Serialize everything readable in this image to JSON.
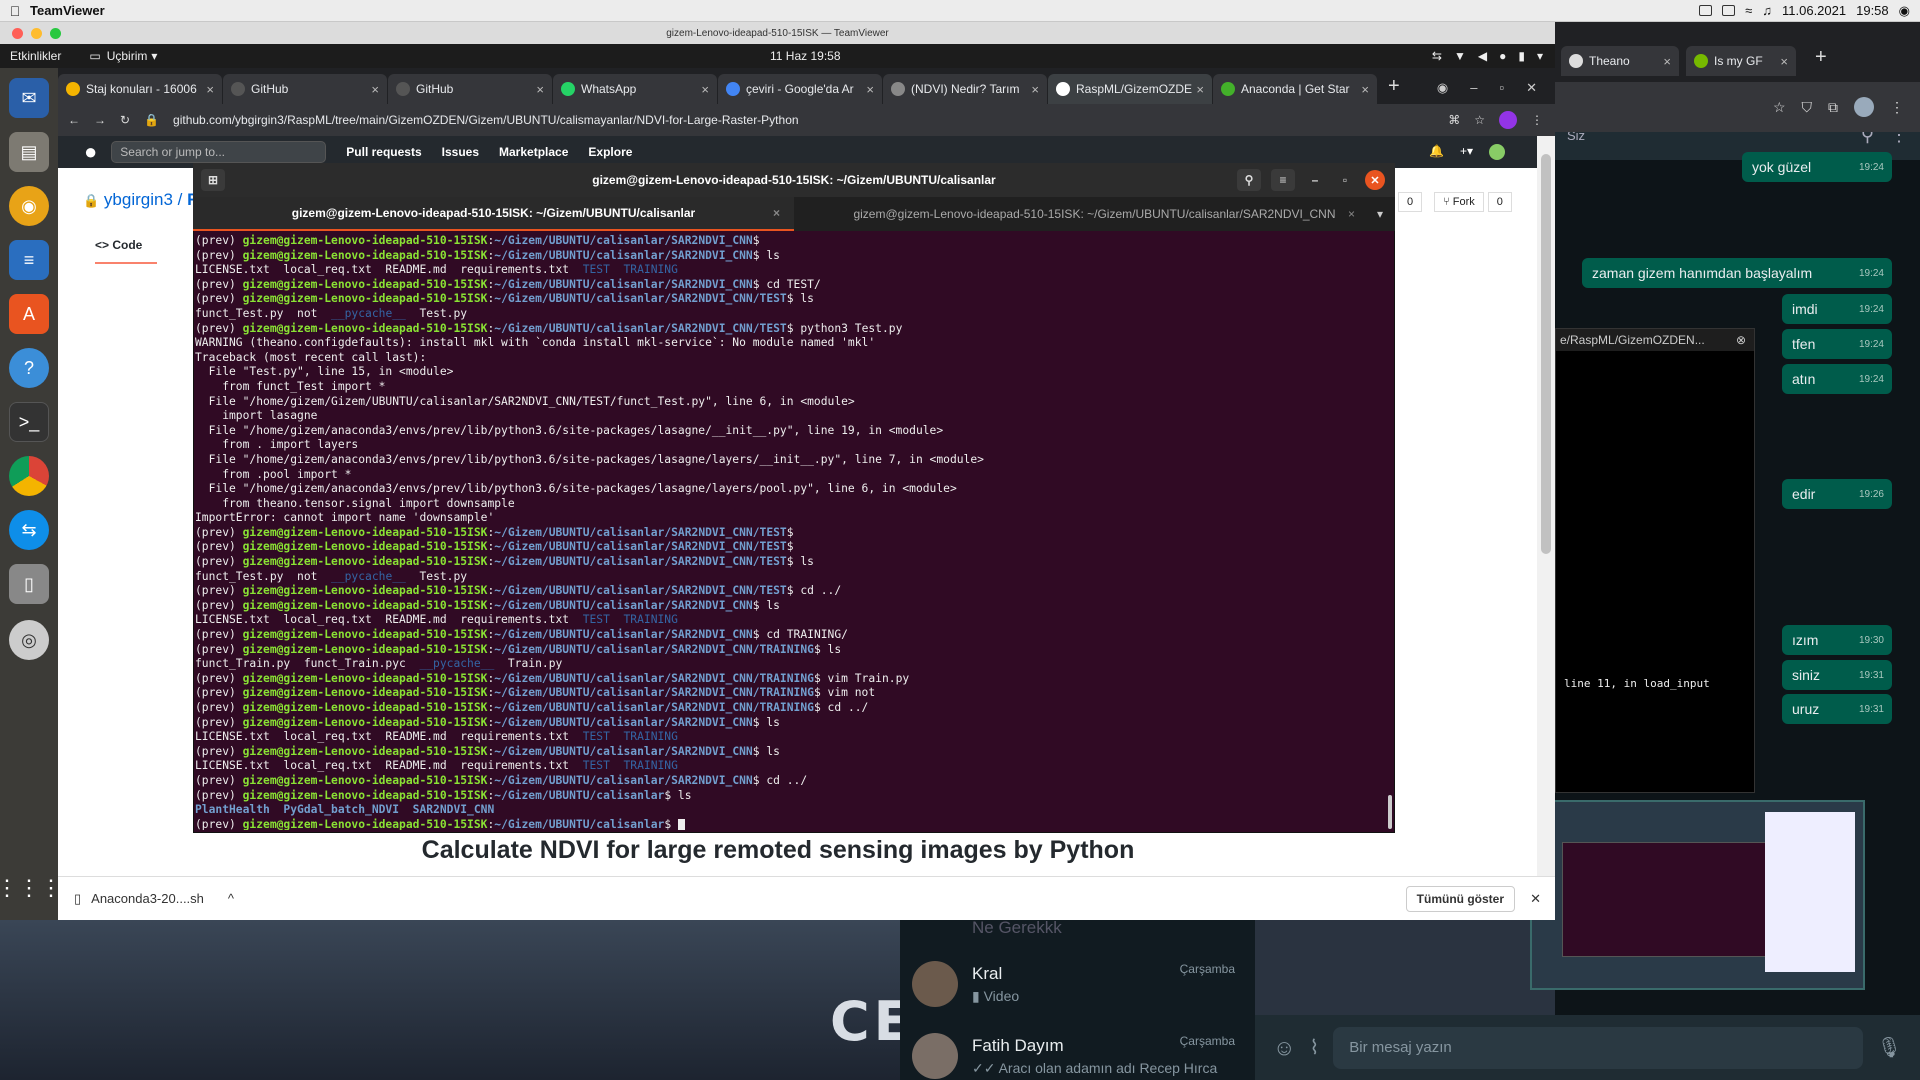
{
  "mac_menubar": {
    "app_name": "TeamViewer",
    "date": "11.06.2021",
    "time": "19:58"
  },
  "teamviewer": {
    "window_title": "gizem-Lenovo-ideapad-510-15ISK — TeamViewer"
  },
  "ubuntu_bar": {
    "activities": "Etkinlikler",
    "app_menu": "Uçbirim",
    "clock": "11 Haz  19:58"
  },
  "chrome": {
    "tabs": [
      {
        "label": "Staj konuları - 16006",
        "color": "#f4b400"
      },
      {
        "label": "GitHub",
        "color": "#555"
      },
      {
        "label": "GitHub",
        "color": "#555"
      },
      {
        "label": "WhatsApp",
        "color": "#25d366"
      },
      {
        "label": "çeviri - Google'da Ar",
        "color": "#4285f4"
      },
      {
        "label": "(NDVI) Nedir? Tarım",
        "color": "#888"
      },
      {
        "label": "RaspML/GizemOZDEN",
        "color": "#fff"
      },
      {
        "label": "Anaconda | Get Star",
        "color": "#43b02a"
      }
    ],
    "url": "github.com/ybgirgin3/RaspML/tree/main/GizemOZDEN/Gizem/UBUNTU/calismayanlar/NDVI-for-Large-Raster-Python",
    "right_tabs": [
      {
        "label": "Theano"
      },
      {
        "label": "Is my GF"
      }
    ]
  },
  "github": {
    "search_placeholder": "Search or jump to...",
    "nav": [
      "Pull requests",
      "Issues",
      "Marketplace",
      "Explore"
    ],
    "repo_owner": "ybgirgin3",
    "repo_sep": "/",
    "repo_name": "R",
    "code_tab": "Code",
    "fork_label": "Fork",
    "fork_count": "0",
    "star_count": "0",
    "readme_title": "Calculate NDVI for large remoted sensing images by Python"
  },
  "downloads": {
    "file": "Anaconda3-20....sh",
    "show_all": "Tümünü göster"
  },
  "terminal": {
    "title": "gizem@gizem-Lenovo-ideapad-510-15ISK: ~/Gizem/UBUNTU/calisanlar",
    "tabs": [
      "gizem@gizem-Lenovo-ideapad-510-15ISK: ~/Gizem/UBUNTU/calisanlar",
      "gizem@gizem-Lenovo-ideapad-510-15ISK: ~/Gizem/UBUNTU/calisanlar/SAR2NDVI_CNN"
    ],
    "lines": [
      [
        [
          "(prev) ",
          ""
        ],
        [
          "gizem@gizem-Lenovo-ideapad-510-15ISK",
          "g"
        ],
        [
          ":",
          ""
        ],
        [
          "~/Gizem/UBUNTU/calisanlar/SAR2NDVI_CNN",
          "b"
        ],
        [
          "$",
          ""
        ]
      ],
      [
        [
          "(prev) ",
          ""
        ],
        [
          "gizem@gizem-Lenovo-ideapad-510-15ISK",
          "g"
        ],
        [
          ":",
          ""
        ],
        [
          "~/Gizem/UBUNTU/calisanlar/SAR2NDVI_CNN",
          "b"
        ],
        [
          "$ ls",
          ""
        ]
      ],
      [
        [
          "LICENSE.txt  local_req.txt  README.md  requirements.txt  ",
          ""
        ],
        [
          "TEST  TRAINING",
          "bl"
        ]
      ],
      [
        [
          "(prev) ",
          ""
        ],
        [
          "gizem@gizem-Lenovo-ideapad-510-15ISK",
          "g"
        ],
        [
          ":",
          ""
        ],
        [
          "~/Gizem/UBUNTU/calisanlar/SAR2NDVI_CNN",
          "b"
        ],
        [
          "$ cd TEST/",
          ""
        ]
      ],
      [
        [
          "(prev) ",
          ""
        ],
        [
          "gizem@gizem-Lenovo-ideapad-510-15ISK",
          "g"
        ],
        [
          ":",
          ""
        ],
        [
          "~/Gizem/UBUNTU/calisanlar/SAR2NDVI_CNN/TEST",
          "b"
        ],
        [
          "$ ls",
          ""
        ]
      ],
      [
        [
          "funct_Test.py  not  ",
          ""
        ],
        [
          "__pycache__",
          "bl"
        ],
        [
          "  Test.py",
          ""
        ]
      ],
      [
        [
          "(prev) ",
          ""
        ],
        [
          "gizem@gizem-Lenovo-ideapad-510-15ISK",
          "g"
        ],
        [
          ":",
          ""
        ],
        [
          "~/Gizem/UBUNTU/calisanlar/SAR2NDVI_CNN/TEST",
          "b"
        ],
        [
          "$ python3 Test.py",
          ""
        ]
      ],
      [
        [
          "WARNING (theano.configdefaults): install mkl with `conda install mkl-service`: No module named 'mkl'",
          ""
        ]
      ],
      [
        [
          "Traceback (most recent call last):",
          ""
        ]
      ],
      [
        [
          "  File \"Test.py\", line 15, in <module>",
          ""
        ]
      ],
      [
        [
          "    from funct_Test import *",
          ""
        ]
      ],
      [
        [
          "  File \"/home/gizem/Gizem/UBUNTU/calisanlar/SAR2NDVI_CNN/TEST/funct_Test.py\", line 6, in <module>",
          ""
        ]
      ],
      [
        [
          "    import lasagne",
          ""
        ]
      ],
      [
        [
          "  File \"/home/gizem/anaconda3/envs/prev/lib/python3.6/site-packages/lasagne/__init__.py\", line 19, in <module>",
          ""
        ]
      ],
      [
        [
          "    from . import layers",
          ""
        ]
      ],
      [
        [
          "  File \"/home/gizem/anaconda3/envs/prev/lib/python3.6/site-packages/lasagne/layers/__init__.py\", line 7, in <module>",
          ""
        ]
      ],
      [
        [
          "    from .pool import *",
          ""
        ]
      ],
      [
        [
          "  File \"/home/gizem/anaconda3/envs/prev/lib/python3.6/site-packages/lasagne/layers/pool.py\", line 6, in <module>",
          ""
        ]
      ],
      [
        [
          "    from theano.tensor.signal import downsample",
          ""
        ]
      ],
      [
        [
          "ImportError: cannot import name 'downsample'",
          ""
        ]
      ],
      [
        [
          "(prev) ",
          ""
        ],
        [
          "gizem@gizem-Lenovo-ideapad-510-15ISK",
          "g"
        ],
        [
          ":",
          ""
        ],
        [
          "~/Gizem/UBUNTU/calisanlar/SAR2NDVI_CNN/TEST",
          "b"
        ],
        [
          "$",
          ""
        ]
      ],
      [
        [
          "(prev) ",
          ""
        ],
        [
          "gizem@gizem-Lenovo-ideapad-510-15ISK",
          "g"
        ],
        [
          ":",
          ""
        ],
        [
          "~/Gizem/UBUNTU/calisanlar/SAR2NDVI_CNN/TEST",
          "b"
        ],
        [
          "$",
          ""
        ]
      ],
      [
        [
          "(prev) ",
          ""
        ],
        [
          "gizem@gizem-Lenovo-ideapad-510-15ISK",
          "g"
        ],
        [
          ":",
          ""
        ],
        [
          "~/Gizem/UBUNTU/calisanlar/SAR2NDVI_CNN/TEST",
          "b"
        ],
        [
          "$ ls",
          ""
        ]
      ],
      [
        [
          "funct_Test.py  not  ",
          ""
        ],
        [
          "__pycache__",
          "bl"
        ],
        [
          "  Test.py",
          ""
        ]
      ],
      [
        [
          "(prev) ",
          ""
        ],
        [
          "gizem@gizem-Lenovo-ideapad-510-15ISK",
          "g"
        ],
        [
          ":",
          ""
        ],
        [
          "~/Gizem/UBUNTU/calisanlar/SAR2NDVI_CNN/TEST",
          "b"
        ],
        [
          "$ cd ../",
          ""
        ]
      ],
      [
        [
          "(prev) ",
          ""
        ],
        [
          "gizem@gizem-Lenovo-ideapad-510-15ISK",
          "g"
        ],
        [
          ":",
          ""
        ],
        [
          "~/Gizem/UBUNTU/calisanlar/SAR2NDVI_CNN",
          "b"
        ],
        [
          "$ ls",
          ""
        ]
      ],
      [
        [
          "LICENSE.txt  local_req.txt  README.md  requirements.txt  ",
          ""
        ],
        [
          "TEST  TRAINING",
          "bl"
        ]
      ],
      [
        [
          "(prev) ",
          ""
        ],
        [
          "gizem@gizem-Lenovo-ideapad-510-15ISK",
          "g"
        ],
        [
          ":",
          ""
        ],
        [
          "~/Gizem/UBUNTU/calisanlar/SAR2NDVI_CNN",
          "b"
        ],
        [
          "$ cd TRAINING/",
          ""
        ]
      ],
      [
        [
          "(prev) ",
          ""
        ],
        [
          "gizem@gizem-Lenovo-ideapad-510-15ISK",
          "g"
        ],
        [
          ":",
          ""
        ],
        [
          "~/Gizem/UBUNTU/calisanlar/SAR2NDVI_CNN/TRAINING",
          "b"
        ],
        [
          "$ ls",
          ""
        ]
      ],
      [
        [
          "funct_Train.py  funct_Train.pyc  ",
          ""
        ],
        [
          "__pycache__",
          "bl"
        ],
        [
          "  Train.py",
          ""
        ]
      ],
      [
        [
          "(prev) ",
          ""
        ],
        [
          "gizem@gizem-Lenovo-ideapad-510-15ISK",
          "g"
        ],
        [
          ":",
          ""
        ],
        [
          "~/Gizem/UBUNTU/calisanlar/SAR2NDVI_CNN/TRAINING",
          "b"
        ],
        [
          "$ vim Train.py",
          ""
        ]
      ],
      [
        [
          "(prev) ",
          ""
        ],
        [
          "gizem@gizem-Lenovo-ideapad-510-15ISK",
          "g"
        ],
        [
          ":",
          ""
        ],
        [
          "~/Gizem/UBUNTU/calisanlar/SAR2NDVI_CNN/TRAINING",
          "b"
        ],
        [
          "$ vim not",
          ""
        ]
      ],
      [
        [
          "(prev) ",
          ""
        ],
        [
          "gizem@gizem-Lenovo-ideapad-510-15ISK",
          "g"
        ],
        [
          ":",
          ""
        ],
        [
          "~/Gizem/UBUNTU/calisanlar/SAR2NDVI_CNN/TRAINING",
          "b"
        ],
        [
          "$ cd ../",
          ""
        ]
      ],
      [
        [
          "(prev) ",
          ""
        ],
        [
          "gizem@gizem-Lenovo-ideapad-510-15ISK",
          "g"
        ],
        [
          ":",
          ""
        ],
        [
          "~/Gizem/UBUNTU/calisanlar/SAR2NDVI_CNN",
          "b"
        ],
        [
          "$ ls",
          ""
        ]
      ],
      [
        [
          "LICENSE.txt  local_req.txt  README.md  requirements.txt  ",
          ""
        ],
        [
          "TEST  TRAINING",
          "bl"
        ]
      ],
      [
        [
          "(prev) ",
          ""
        ],
        [
          "gizem@gizem-Lenovo-ideapad-510-15ISK",
          "g"
        ],
        [
          ":",
          ""
        ],
        [
          "~/Gizem/UBUNTU/calisanlar/SAR2NDVI_CNN",
          "b"
        ],
        [
          "$ ls",
          ""
        ]
      ],
      [
        [
          "LICENSE.txt  local_req.txt  README.md  requirements.txt  ",
          ""
        ],
        [
          "TEST  TRAINING",
          "bl"
        ]
      ],
      [
        [
          "(prev) ",
          ""
        ],
        [
          "gizem@gizem-Lenovo-ideapad-510-15ISK",
          "g"
        ],
        [
          ":",
          ""
        ],
        [
          "~/Gizem/UBUNTU/calisanlar/SAR2NDVI_CNN",
          "b"
        ],
        [
          "$ cd ../",
          ""
        ]
      ],
      [
        [
          "(prev) ",
          ""
        ],
        [
          "gizem@gizem-Lenovo-ideapad-510-15ISK",
          "g"
        ],
        [
          ":",
          ""
        ],
        [
          "~/Gizem/UBUNTU/calisanlar",
          "b"
        ],
        [
          "$ ls",
          ""
        ]
      ],
      [
        [
          "PlantHealth  PyGdal_batch_NDVI  SAR2NDVI_CNN",
          "b"
        ]
      ],
      [
        [
          "(prev) ",
          ""
        ],
        [
          "gizem@gizem-Lenovo-ideapad-510-15ISK",
          "g"
        ],
        [
          ":",
          ""
        ],
        [
          "~/Gizem/UBUNTU/calisanlar",
          "b"
        ],
        [
          "$ ",
          ""
        ]
      ]
    ]
  },
  "whatsapp": {
    "search_placeholder": "Siz",
    "messages": [
      {
        "text": "yok güzel",
        "time": "19:24"
      },
      {
        "text": "zaman gizem hanımdan başlayalım",
        "time": "19:24"
      },
      {
        "text": "imdi",
        "time": "19:24"
      },
      {
        "text": "tfen",
        "time": "19:24"
      },
      {
        "text": "atın",
        "time": "19:24"
      },
      {
        "text": "edir",
        "time": "19:26"
      },
      {
        "text": "ızım",
        "time": "19:30"
      },
      {
        "text": "siniz",
        "time": "19:31"
      },
      {
        "text": "uruz",
        "time": "19:31"
      }
    ],
    "overlay_tab": "e/RaspML/GizemOZDEN...",
    "overlay_text": "line 11, in load_input",
    "chats": [
      {
        "name": "Ne Gerekkk",
        "sub": "",
        "date": ""
      },
      {
        "name": "Kral",
        "sub": "Video",
        "date": "Çarşamba"
      },
      {
        "name": "Fatih Dayım",
        "sub": "Aracı olan adamın adı Recep Hırca",
        "date": "Çarşamba"
      }
    ],
    "compose_placeholder": "Bir mesaj yazın"
  }
}
